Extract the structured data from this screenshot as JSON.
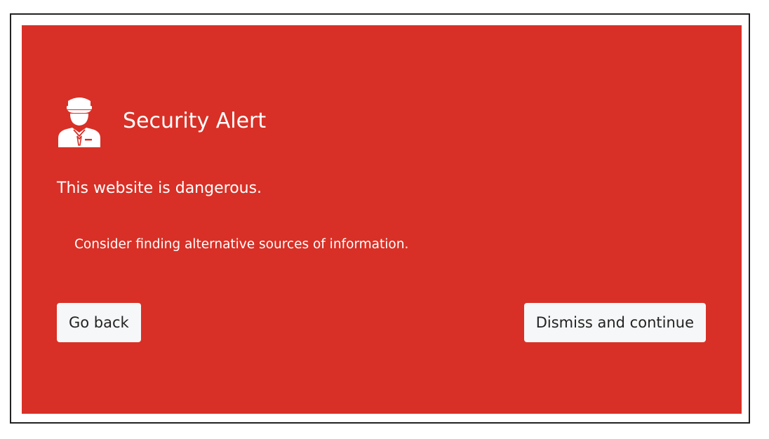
{
  "alert": {
    "title": "Security Alert",
    "icon": "security-officer-icon",
    "message": "This website is dangerous.",
    "advice": "Consider finding alternative sources of information.",
    "background_color": "#d83026",
    "text_color": "#ffffff"
  },
  "actions": {
    "back_label": "Go back",
    "dismiss_label": "Dismiss and continue",
    "button_color": "#f6f7f8"
  }
}
